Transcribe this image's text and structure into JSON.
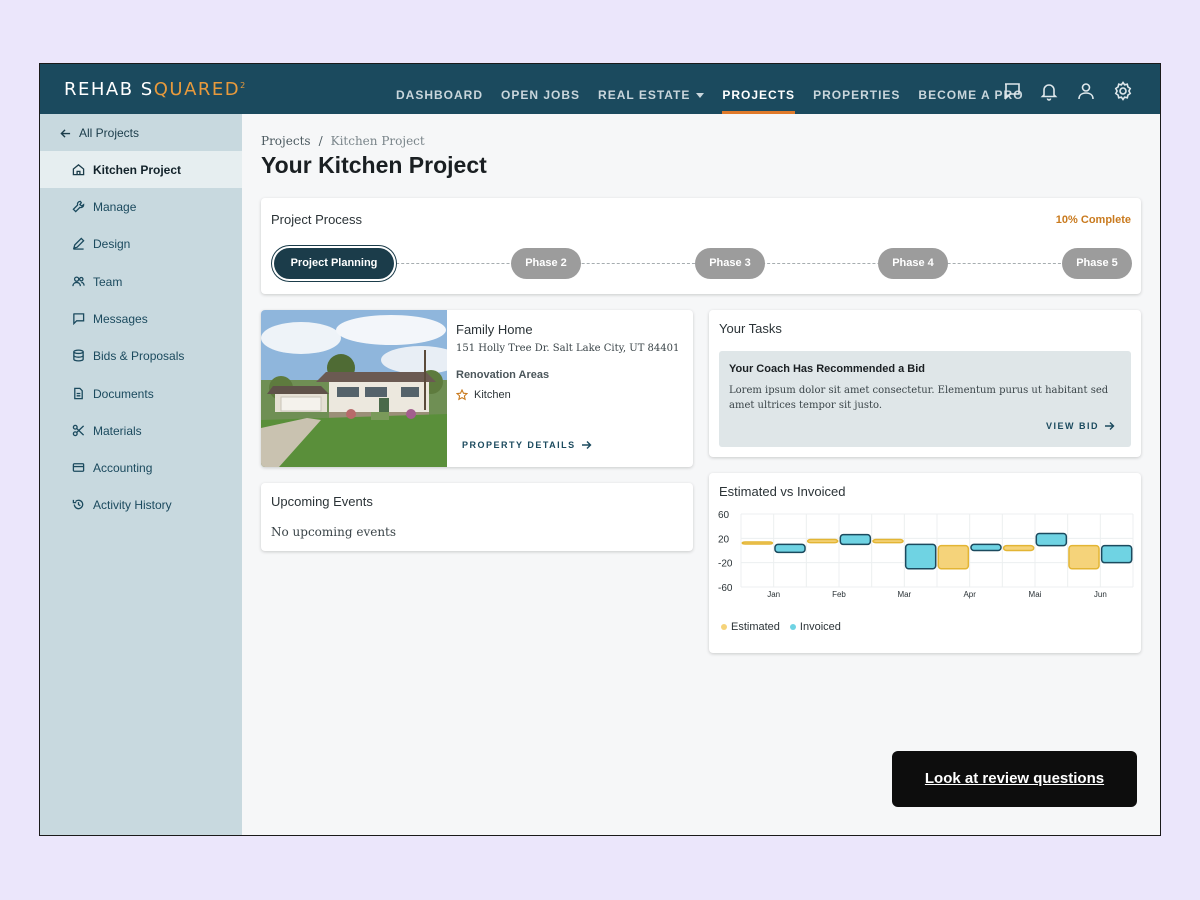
{
  "brand": {
    "logo_part1": "REHAB S",
    "logo_accent": "QUARED",
    "logo_sup": "2"
  },
  "nav": {
    "links": [
      {
        "label": "DASHBOARD"
      },
      {
        "label": "OPEN JOBS"
      },
      {
        "label": "REAL ESTATE"
      },
      {
        "label": "PROJECTS"
      },
      {
        "label": "PROPERTIES"
      },
      {
        "label": "BECOME A PRO"
      }
    ],
    "active": "PROJECTS",
    "icons": [
      "chat-icon",
      "bell-icon",
      "user-icon",
      "gear-icon"
    ]
  },
  "sidebar": {
    "back_label": "All Projects",
    "items": [
      {
        "label": "Kitchen Project",
        "icon": "home-icon"
      },
      {
        "label": "Manage",
        "icon": "wrench-icon"
      },
      {
        "label": "Design",
        "icon": "pencil-icon"
      },
      {
        "label": "Team",
        "icon": "team-icon"
      },
      {
        "label": "Messages",
        "icon": "message-icon"
      },
      {
        "label": "Bids & Proposals",
        "icon": "database-icon"
      },
      {
        "label": "Documents",
        "icon": "document-icon"
      },
      {
        "label": "Materials",
        "icon": "scissors-icon"
      },
      {
        "label": "Accounting",
        "icon": "card-icon"
      },
      {
        "label": "Activity History",
        "icon": "history-icon"
      }
    ]
  },
  "breadcrumb": {
    "root": "Projects",
    "separator": "/",
    "current": "Kitchen Project"
  },
  "page_title": "Your Kitchen Project",
  "process": {
    "title": "Project Process",
    "complete": "10% Complete",
    "phases": [
      "Project Planning",
      "Phase 2",
      "Phase 3",
      "Phase 4",
      "Phase 5"
    ]
  },
  "property": {
    "name": "Family Home",
    "address": "151 Holly Tree Dr. Salt Lake City, UT 84401",
    "renovation_label": "Renovation Areas",
    "renovation_item": "Kitchen",
    "details_link": "PROPERTY DETAILS"
  },
  "events": {
    "title": "Upcoming Events",
    "empty_text": "No upcoming events"
  },
  "tasks": {
    "title": "Your Tasks",
    "item_title": "Your Coach Has Recommended a Bid",
    "item_body": "Lorem ipsum dolor sit amet consectetur. Elementum purus ut habitant sed amet ultrices tempor sit justo.",
    "item_link": "VIEW BID"
  },
  "chart_title": "Estimated vs Invoiced",
  "chart_data": {
    "type": "bar",
    "categories": [
      "Jan",
      "Feb",
      "Mar",
      "Apr",
      "Mai",
      "Jun"
    ],
    "y_ticks": [
      "60",
      "20",
      "-20",
      "-60"
    ],
    "ylim": [
      -60,
      60
    ],
    "series": [
      {
        "name": "Estimated",
        "color": "#f5d37a",
        "stroke": "#e3b534",
        "ranges": [
          [
            12,
            14
          ],
          [
            13,
            18
          ],
          [
            13,
            18
          ],
          [
            -30,
            8
          ],
          [
            0,
            8
          ],
          [
            -30,
            8
          ]
        ]
      },
      {
        "name": "Invoiced",
        "color": "#6fd3e3",
        "stroke": "#1b4a5e",
        "ranges": [
          [
            -3,
            10
          ],
          [
            10,
            26
          ],
          [
            -30,
            10
          ],
          [
            0,
            10
          ],
          [
            8,
            28
          ],
          [
            -20,
            8
          ]
        ]
      }
    ],
    "legend": "bottom-left",
    "grid": true
  },
  "review_button": "Look at review questions"
}
